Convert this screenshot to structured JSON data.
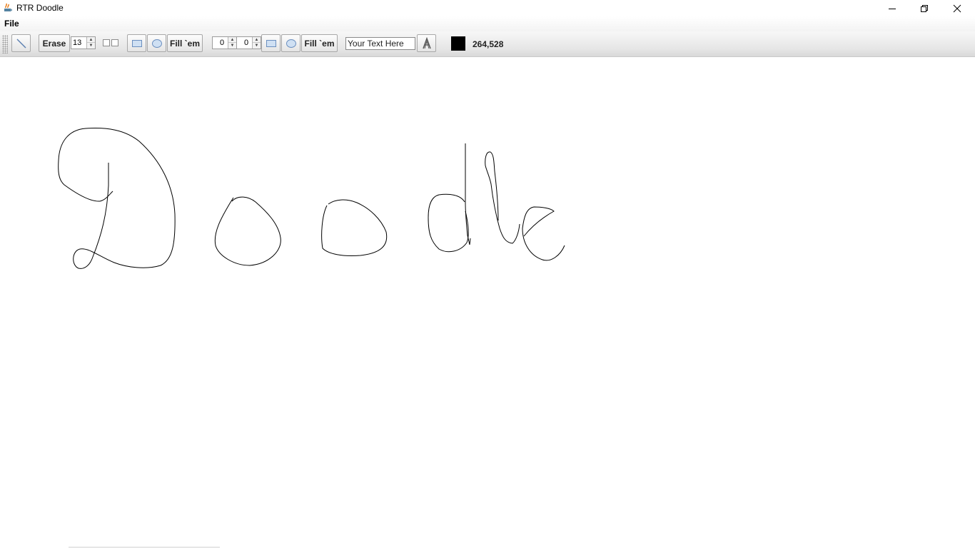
{
  "window": {
    "title": "RTR Doodle",
    "controls": [
      "minimize-icon",
      "restore-icon",
      "close-icon"
    ]
  },
  "menu": {
    "file_label": "File"
  },
  "toolbar": {
    "line_tool_icon": "line-icon",
    "erase_label": "Erase",
    "brush_size": "13",
    "pair_icon": "two-squares-icon",
    "rect_icon": "rectangle-icon",
    "oval_icon": "oval-icon",
    "fill_label_1": "Fill `em",
    "width_value": "0",
    "height_value": "0",
    "rect_icon_2": "rectangle-icon",
    "oval_icon_2": "oval-icon",
    "fill_label_2": "Fill `em",
    "text_input_value": "Your Text Here",
    "text_tool_icon": "font-a-icon",
    "current_color": "#000000",
    "cursor_coords": "264,528"
  },
  "canvas": {
    "background": "#ffffff",
    "drawing": "handwritten word strokes"
  }
}
